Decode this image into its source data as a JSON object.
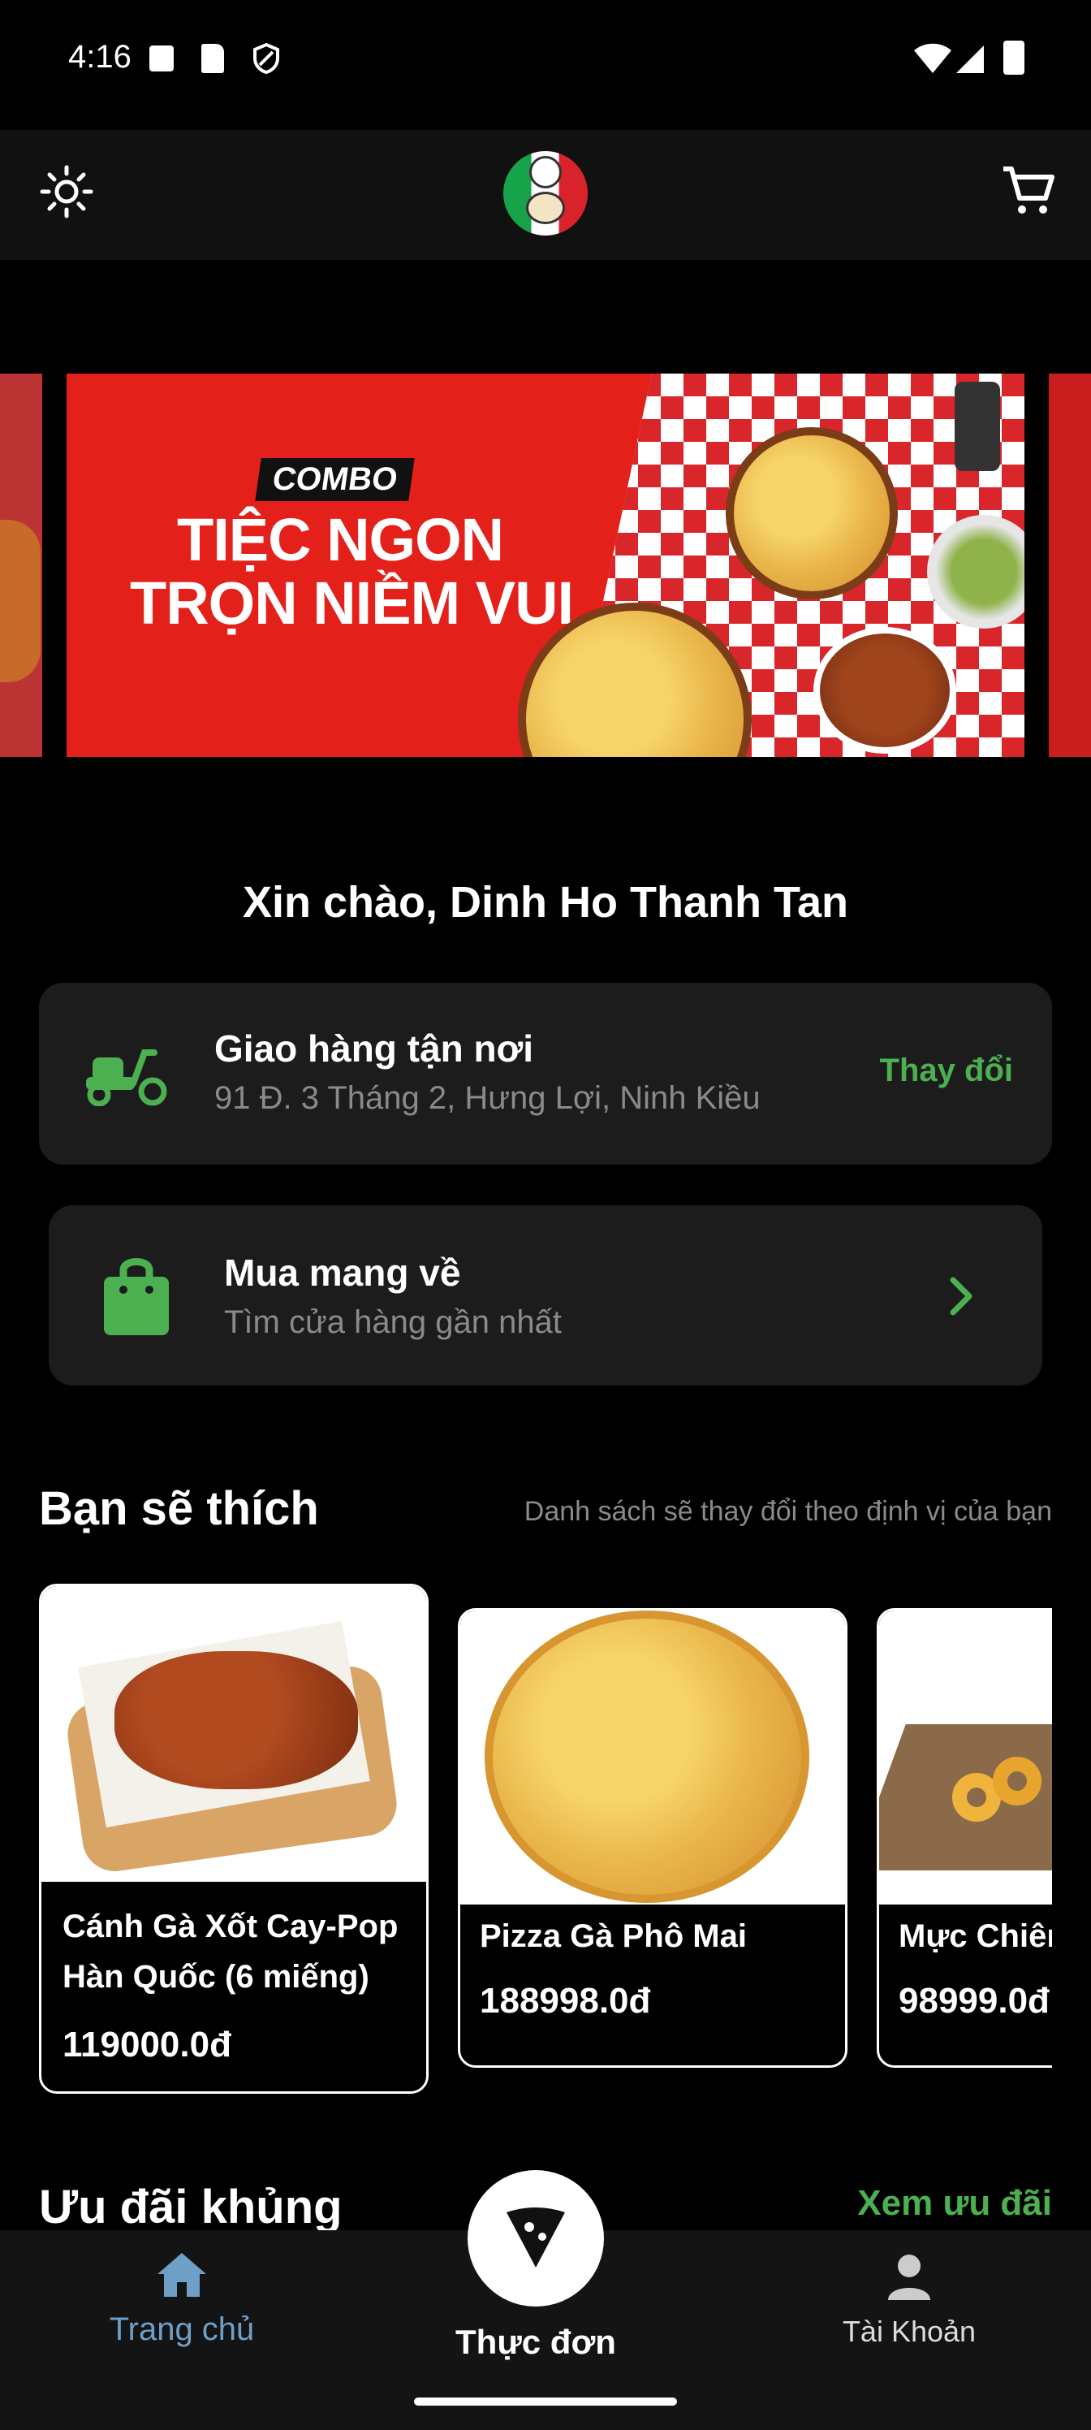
{
  "status_bar": {
    "time": "4:16"
  },
  "banner": {
    "badge": "COMBO",
    "line1": "TIỆC NGON",
    "line2": "TRỌN NIỀM VUI"
  },
  "greeting": "Xin chào, Dinh Ho Thanh Tan",
  "delivery": {
    "title": "Giao hàng tận nơi",
    "address": "91 Đ. 3 Tháng 2, Hưng Lợi, Ninh Kiều",
    "action": "Thay đổi"
  },
  "takeaway": {
    "title": "Mua mang về",
    "subtitle": "Tìm cửa hàng gần nhất"
  },
  "recommend": {
    "title": "Bạn sẽ thích",
    "note": "Danh sách sẽ thay đổi theo định vị của bạn",
    "items": [
      {
        "name_line1": "Cánh Gà Xốt Cay-Pop",
        "name_line2": "Hàn Quốc (6 miếng)",
        "price": "119000.0đ"
      },
      {
        "name": "Pizza Gà Phô Mai",
        "price": "188998.0đ"
      },
      {
        "name": "Mực Chiên",
        "price": "98999.0đ"
      }
    ]
  },
  "deals": {
    "title": "Ưu đãi khủng",
    "action": "Xem ưu đãi"
  },
  "nav": {
    "home": "Trang chủ",
    "menu": "Thực đơn",
    "account": "Tài Khoản"
  },
  "colors": {
    "accent": "#4caf50",
    "nav_active": "#6e9fc8",
    "banner_red": "#e4201b"
  }
}
